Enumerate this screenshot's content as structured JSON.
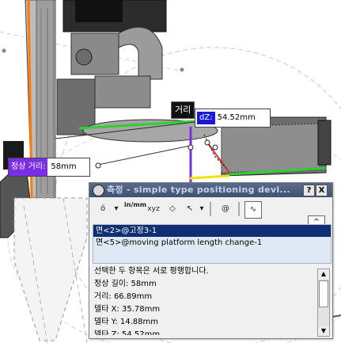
{
  "overlays": {
    "distance_label": "거리",
    "dz_label": "dZ:",
    "dz_value": "54.52mm",
    "normal_distance_label": "정상 거리:",
    "normal_distance_value": "58mm"
  },
  "dialog": {
    "title": "측정 - simple type positioning devi...",
    "help_label": "?",
    "close_label": "X",
    "collapse_label": "^",
    "toolbar": {
      "arc_options_label": "ö",
      "units_label": "in/mm",
      "xyz_label": "xyz",
      "projection_label": "◇",
      "history_label": "↖",
      "sensor_label": "@",
      "graph_label": "∿"
    },
    "selections": [
      "면<2>@고정3-1",
      "면<5>@moving platform length change-1"
    ],
    "results": [
      "선택한 두 항목은 서로 평행합니다.",
      "정상 길이: 58mm",
      "거리: 66.89mm",
      "델타 X: 35.78mm",
      "델타 Y: 14.88mm",
      "델타 Z: 54.52mm"
    ]
  },
  "colors": {
    "title_bar": "#4a5c80",
    "selection_bg": "#0f2f72",
    "dz_badge": "#1a1ad6",
    "normal_badge": "#7a2ee6",
    "green_edge": "#2fd02f",
    "orange_edge": "#ff7a00"
  }
}
